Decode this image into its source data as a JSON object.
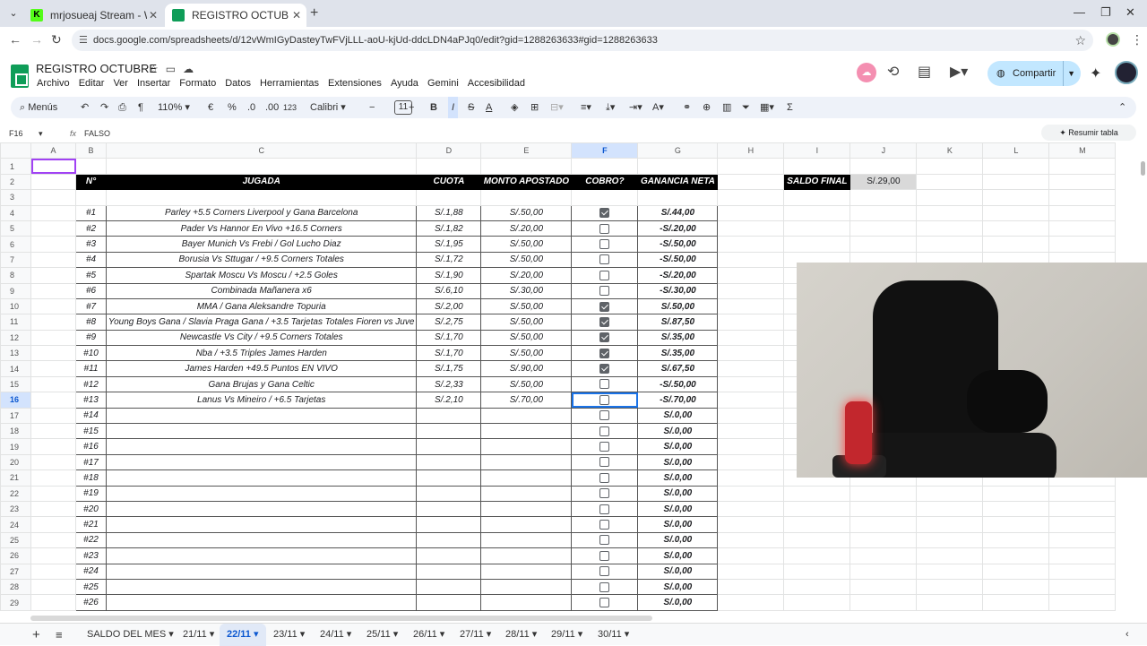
{
  "browser": {
    "tabs": [
      {
        "title": "mrjosueaj Stream - Watch Live"
      },
      {
        "title": "REGISTRO OCTUBRE - Hojas de cálculo"
      }
    ],
    "url": "docs.google.com/spreadsheets/d/12vWmIGyDasteyTwFVjLLL-aoU-kjUd-ddcLDN4aPJq0/edit?gid=1288263633#gid=1288263633"
  },
  "doc": {
    "title": "REGISTRO OCTUBRE",
    "menus": [
      "Archivo",
      "Editar",
      "Ver",
      "Insertar",
      "Formato",
      "Datos",
      "Herramientas",
      "Extensiones",
      "Ayuda",
      "Gemini",
      "Accesibilidad"
    ],
    "share_label": "Compartir"
  },
  "toolbar": {
    "menus_label": "Menús",
    "zoom": "110%",
    "currency": "€",
    "percent": "%",
    "dec_less": ".0",
    "dec_more": ".00",
    "num_format": "123",
    "font": "Calibri",
    "font_size": "11"
  },
  "formula": {
    "cell": "F16",
    "value": "FALSO",
    "summary_button": "Resumir tabla"
  },
  "columns": [
    "A",
    "B",
    "C",
    "D",
    "E",
    "F",
    "G",
    "H",
    "I",
    "J",
    "K",
    "L",
    "M"
  ],
  "headers": {
    "num": "N°",
    "play": "JUGADA",
    "odds": "CUOTA",
    "stake": "MONTO APOSTADO",
    "won": "COBRO?",
    "net": "GANANCIA NETA"
  },
  "saldo": {
    "label": "SALDO FINAL",
    "value": "S/.29,00"
  },
  "bets": [
    {
      "row": "4",
      "num": "#1",
      "play": "Parley +5.5 Corners Liverpool y Gana Barcelona",
      "odds": "S/.1,88",
      "stake": "S/.50,00",
      "won": true,
      "net": "S/.44,00"
    },
    {
      "row": "5",
      "num": "#2",
      "play": "Pader Vs Hannor En Vivo +16.5 Corners",
      "odds": "S/.1,82",
      "stake": "S/.20,00",
      "won": false,
      "net": "-S/.20,00"
    },
    {
      "row": "6",
      "num": "#3",
      "play": "Bayer Munich Vs Frebi / Gol Lucho Diaz",
      "odds": "S/.1,95",
      "stake": "S/.50,00",
      "won": false,
      "net": "-S/.50,00"
    },
    {
      "row": "7",
      "num": "#4",
      "play": "Borusia Vs Sttugar / +9.5 Corners Totales",
      "odds": "S/.1,72",
      "stake": "S/.50,00",
      "won": false,
      "net": "-S/.50,00"
    },
    {
      "row": "8",
      "num": "#5",
      "play": "Spartak Moscu Vs Moscu / +2.5 Goles",
      "odds": "S/.1,90",
      "stake": "S/.20,00",
      "won": false,
      "net": "-S/.20,00"
    },
    {
      "row": "9",
      "num": "#6",
      "play": "Combinada Mañanera x6",
      "odds": "S/.6,10",
      "stake": "S/.30,00",
      "won": false,
      "net": "-S/.30,00"
    },
    {
      "row": "10",
      "num": "#7",
      "play": "MMA / Gana Aleksandre Topuria",
      "odds": "S/.2,00",
      "stake": "S/.50,00",
      "won": true,
      "net": "S/.50,00"
    },
    {
      "row": "11",
      "num": "#8",
      "play": "Young Boys Gana / Slavia Praga Gana / +3.5 Tarjetas Totales Fioren vs Juve",
      "odds": "S/.2,75",
      "stake": "S/.50,00",
      "won": true,
      "net": "S/.87,50"
    },
    {
      "row": "12",
      "num": "#9",
      "play": "Newcastle Vs City / +9.5 Corners Totales",
      "odds": "S/.1,70",
      "stake": "S/.50,00",
      "won": true,
      "net": "S/.35,00"
    },
    {
      "row": "13",
      "num": "#10",
      "play": "Nba / +3.5 Triples James Harden",
      "odds": "S/.1,70",
      "stake": "S/.50,00",
      "won": true,
      "net": "S/.35,00"
    },
    {
      "row": "14",
      "num": "#11",
      "play": "James Harden +49.5 Puntos EN VIVO",
      "odds": "S/.1,75",
      "stake": "S/.90,00",
      "won": true,
      "net": "S/.67,50"
    },
    {
      "row": "15",
      "num": "#12",
      "play": "Gana Brujas y Gana Celtic",
      "odds": "S/.2,33",
      "stake": "S/.50,00",
      "won": false,
      "net": "-S/.50,00"
    },
    {
      "row": "16",
      "num": "#13",
      "play": "Lanus Vs Mineiro / +6.5 Tarjetas",
      "odds": "S/.2,10",
      "stake": "S/.70,00",
      "won": false,
      "net": "-S/.70,00"
    },
    {
      "row": "17",
      "num": "#14",
      "play": "",
      "odds": "",
      "stake": "",
      "won": false,
      "net": "S/.0,00"
    },
    {
      "row": "18",
      "num": "#15",
      "play": "",
      "odds": "",
      "stake": "",
      "won": false,
      "net": "S/.0,00"
    },
    {
      "row": "19",
      "num": "#16",
      "play": "",
      "odds": "",
      "stake": "",
      "won": false,
      "net": "S/.0,00"
    },
    {
      "row": "20",
      "num": "#17",
      "play": "",
      "odds": "",
      "stake": "",
      "won": false,
      "net": "S/.0,00"
    },
    {
      "row": "21",
      "num": "#18",
      "play": "",
      "odds": "",
      "stake": "",
      "won": false,
      "net": "S/.0,00"
    },
    {
      "row": "22",
      "num": "#19",
      "play": "",
      "odds": "",
      "stake": "",
      "won": false,
      "net": "S/.0,00"
    },
    {
      "row": "23",
      "num": "#20",
      "play": "",
      "odds": "",
      "stake": "",
      "won": false,
      "net": "S/.0,00"
    },
    {
      "row": "24",
      "num": "#21",
      "play": "",
      "odds": "",
      "stake": "",
      "won": false,
      "net": "S/.0,00"
    },
    {
      "row": "25",
      "num": "#22",
      "play": "",
      "odds": "",
      "stake": "",
      "won": false,
      "net": "S/.0,00"
    },
    {
      "row": "26",
      "num": "#23",
      "play": "",
      "odds": "",
      "stake": "",
      "won": false,
      "net": "S/.0,00"
    },
    {
      "row": "27",
      "num": "#24",
      "play": "",
      "odds": "",
      "stake": "",
      "won": false,
      "net": "S/.0,00"
    },
    {
      "row": "28",
      "num": "#25",
      "play": "",
      "odds": "",
      "stake": "",
      "won": false,
      "net": "S/.0,00"
    },
    {
      "row": "29",
      "num": "#26",
      "play": "",
      "odds": "",
      "stake": "",
      "won": false,
      "net": "S/.0,00"
    }
  ],
  "sheet_tabs": [
    "SALDO DEL MES",
    "21/11",
    "22/11",
    "23/11",
    "24/11",
    "25/11",
    "26/11",
    "27/11",
    "28/11",
    "29/11",
    "30/11"
  ],
  "active_sheet": "22/11",
  "colors": {
    "accent": "#0b57d0",
    "share_bg": "#c2e7ff",
    "header_black": "#000000",
    "selection": "#1a73e8"
  }
}
